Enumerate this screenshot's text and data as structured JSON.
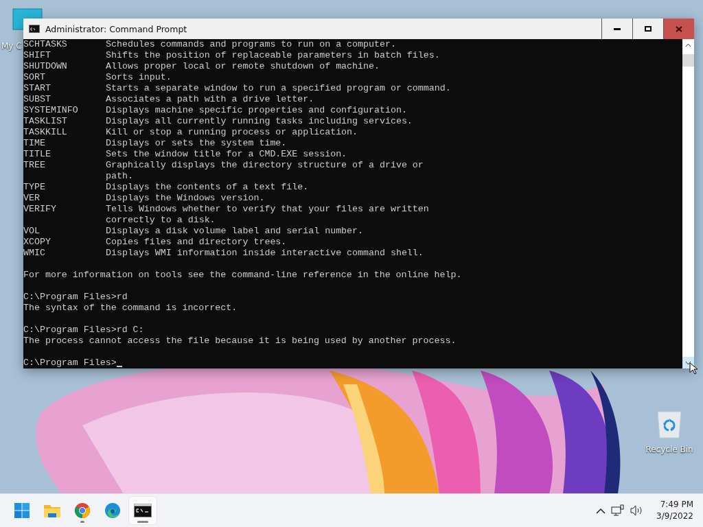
{
  "desktop_icons": [
    {
      "kind": "computer",
      "label": "My C"
    },
    {
      "kind": "recycle",
      "label": "Recycle Bin"
    }
  ],
  "window": {
    "title": "Administrator: Command Prompt"
  },
  "console": {
    "commands": [
      {
        "name": "SCHTASKS",
        "description": [
          "Schedules commands and programs to run on a computer."
        ]
      },
      {
        "name": "SHIFT",
        "description": [
          "Shifts the position of replaceable parameters in batch files."
        ]
      },
      {
        "name": "SHUTDOWN",
        "description": [
          "Allows proper local or remote shutdown of machine."
        ]
      },
      {
        "name": "SORT",
        "description": [
          "Sorts input."
        ]
      },
      {
        "name": "START",
        "description": [
          "Starts a separate window to run a specified program or command."
        ]
      },
      {
        "name": "SUBST",
        "description": [
          "Associates a path with a drive letter."
        ]
      },
      {
        "name": "SYSTEMINFO",
        "description": [
          "Displays machine specific properties and configuration."
        ]
      },
      {
        "name": "TASKLIST",
        "description": [
          "Displays all currently running tasks including services."
        ]
      },
      {
        "name": "TASKKILL",
        "description": [
          "Kill or stop a running process or application."
        ]
      },
      {
        "name": "TIME",
        "description": [
          "Displays or sets the system time."
        ]
      },
      {
        "name": "TITLE",
        "description": [
          "Sets the window title for a CMD.EXE session."
        ]
      },
      {
        "name": "TREE",
        "description": [
          "Graphically displays the directory structure of a drive or",
          "path."
        ]
      },
      {
        "name": "TYPE",
        "description": [
          "Displays the contents of a text file."
        ]
      },
      {
        "name": "VER",
        "description": [
          "Displays the Windows version."
        ]
      },
      {
        "name": "VERIFY",
        "description": [
          "Tells Windows whether to verify that your files are written",
          "correctly to a disk."
        ]
      },
      {
        "name": "VOL",
        "description": [
          "Displays a disk volume label and serial number."
        ]
      },
      {
        "name": "XCOPY",
        "description": [
          "Copies files and directory trees."
        ]
      },
      {
        "name": "WMIC",
        "description": [
          "Displays WMI information inside interactive command shell."
        ]
      }
    ],
    "blocks": [
      [
        "For more information on tools see the command-line reference in the online help."
      ],
      [
        "C:\\Program Files>rd",
        "The syntax of the command is incorrect."
      ],
      [
        "C:\\Program Files>rd C:",
        "The process cannot access the file because it is being used by another process."
      ]
    ],
    "prompt": "C:\\Program Files>"
  },
  "taskbar": {
    "apps": [
      {
        "kind": "start",
        "running": false,
        "selected": false
      },
      {
        "kind": "explorer",
        "running": false,
        "selected": false
      },
      {
        "kind": "chrome",
        "running": true,
        "selected": false
      },
      {
        "kind": "edge",
        "running": false,
        "selected": false
      },
      {
        "kind": "terminal",
        "running": true,
        "selected": true
      }
    ],
    "time": "7:49 PM",
    "date": "3/9/2022"
  }
}
